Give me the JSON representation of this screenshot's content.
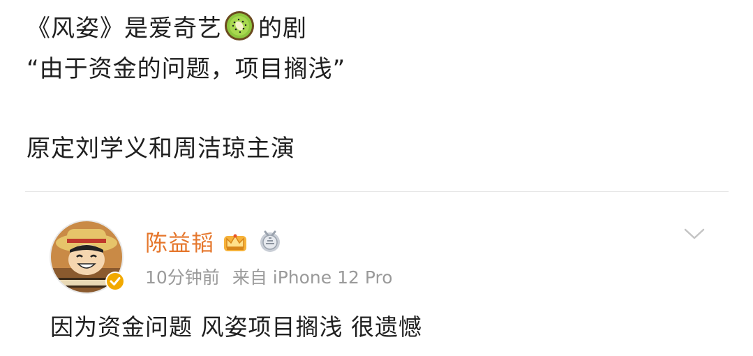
{
  "post": {
    "line1_before": "《风姿》是爱奇艺",
    "line1_after": "的剧",
    "line2": "“由于资金的问题，项目搁浅”",
    "line3": "原定刘学义和周洁琼主演",
    "inline_icon": "kiwi-emoji-icon"
  },
  "repost": {
    "username": "陈益韬",
    "time": "10分钟前",
    "source": "来自 iPhone 12 Pro",
    "comment": "因为资金问题 风姿项目搁浅 很遗憾",
    "icons": [
      "avatar",
      "verified-badge-icon",
      "crown-badge-icon",
      "medal-badge-icon",
      "chevron-down-icon"
    ]
  },
  "colors": {
    "username": "#e5762b",
    "meta": "#9a9a9a",
    "text": "#1f1f1f",
    "verified": "#f2a900",
    "divider": "#e6e6e6"
  }
}
